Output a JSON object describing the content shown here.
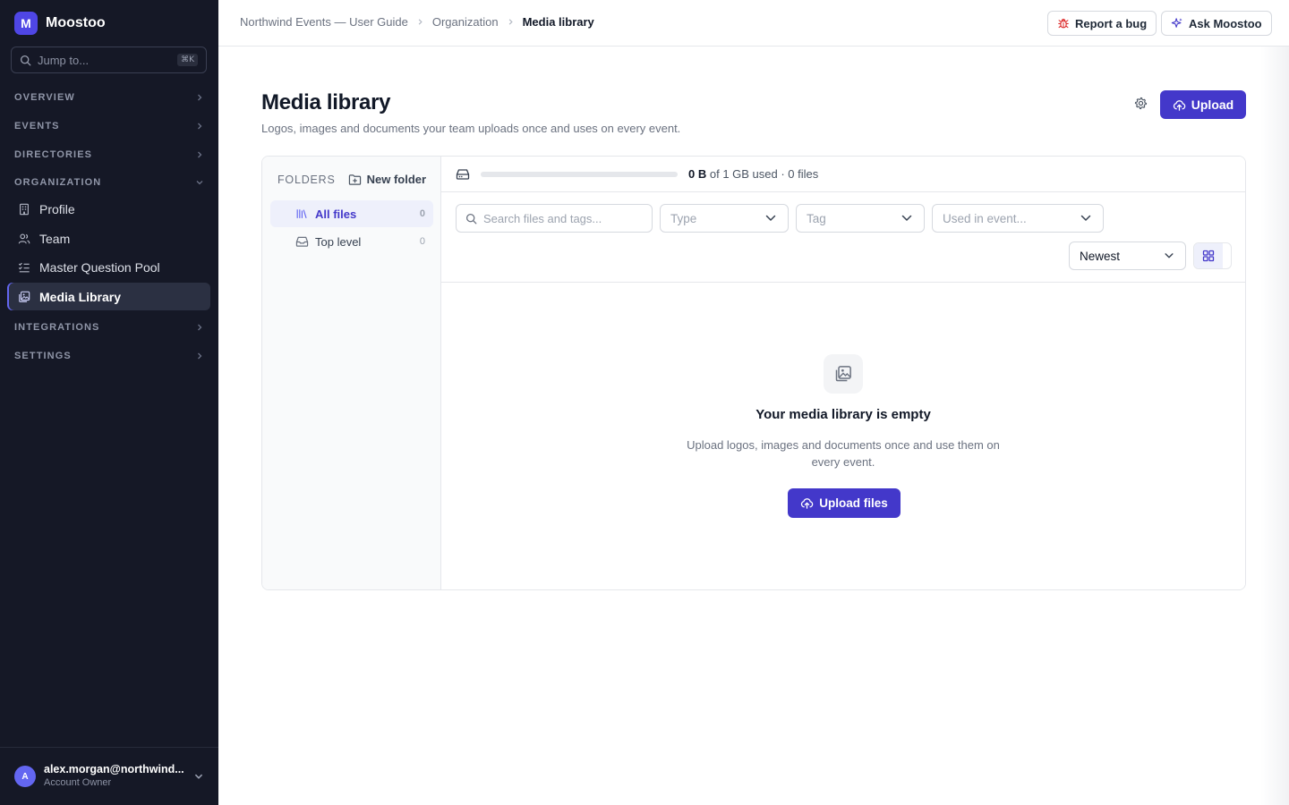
{
  "app": {
    "logo_letter": "M",
    "name": "Moostoo"
  },
  "sidebar": {
    "jump_placeholder": "Jump to...",
    "jump_shortcut": "⌘K",
    "sections": {
      "overview": "OVERVIEW",
      "events": "EVENTS",
      "directories": "DIRECTORIES",
      "organization": "ORGANIZATION",
      "integrations": "INTEGRATIONS",
      "settings": "SETTINGS"
    },
    "organization_items": [
      "Profile",
      "Team",
      "Master Question Pool",
      "Media Library"
    ],
    "active_item": "Media Library",
    "user": {
      "initial": "A",
      "email": "alex.morgan@northwind...",
      "role": "Account Owner"
    }
  },
  "topbar": {
    "breadcrumb": [
      "Northwind Events — User Guide",
      "Organization",
      "Media library"
    ],
    "report_bug_label": "Report a bug",
    "ask_label": "Ask Moostoo"
  },
  "page": {
    "title": "Media library",
    "subtitle": "Logos, images and documents your team uploads once and uses on every event.",
    "upload_label": "Upload"
  },
  "folders": {
    "label": "FOLDERS",
    "new_folder_label": "New folder",
    "items": [
      {
        "label": "All files",
        "count": "0"
      },
      {
        "label": "Top level",
        "count": "0"
      }
    ]
  },
  "storage": {
    "used": "0 B",
    "rest": "of 1 GB used · 0 files",
    "fraction_used": 0
  },
  "filters": {
    "search_placeholder": "Search files and tags...",
    "type_placeholder": "Type",
    "tag_placeholder": "Tag",
    "event_placeholder": "Used in event...",
    "sort_value": "Newest"
  },
  "empty_state": {
    "title": "Your media library is empty",
    "text": "Upload logos, images and documents once and use them on every event.",
    "button_label": "Upload files"
  },
  "colors": {
    "accent": "#4338ca",
    "sidebar_bg": "#151826",
    "active_folder_bg": "#eef0fb"
  }
}
